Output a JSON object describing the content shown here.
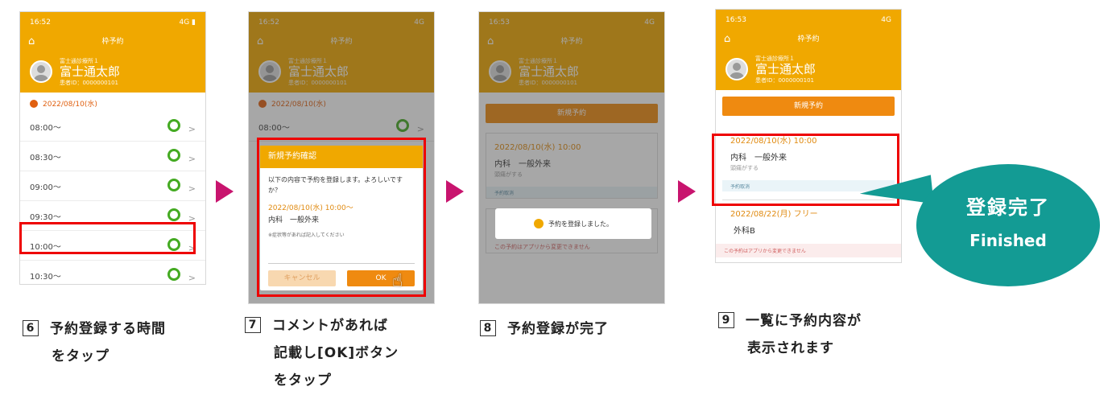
{
  "p6": {
    "time": "16:52",
    "signal": "4G",
    "title": "枠予約",
    "hospital": "富士通診療所１",
    "name": "富士通太郎",
    "pid": "患者ID：0000000101",
    "date": "2022/08/10(水)",
    "slots": [
      "08:00〜",
      "08:30〜",
      "09:00〜",
      "09:30〜",
      "10:00〜",
      "10:30〜"
    ]
  },
  "p7": {
    "time": "16:52",
    "signal": "4G",
    "title": "枠予約",
    "hospital": "富士通診療所１",
    "name": "富士通太郎",
    "pid": "患者ID：0000000101",
    "date": "2022/08/10(水)",
    "slot": "08:00〜",
    "dialog": {
      "title": "新規予約確認",
      "message": "以下の内容で予約を登録します。よろしいですか？",
      "datetime": "2022/08/10(水) 10:00〜",
      "dept": "内科　一般外来",
      "note": "※症状等があれば記入してください",
      "cancel": "キャンセル",
      "ok": "OK"
    }
  },
  "p8": {
    "time": "16:53",
    "signal": "4G",
    "title": "枠予約",
    "hospital": "富士通診療所１",
    "name": "富士通太郎",
    "pid": "患者ID：0000000101",
    "new_btn": "新規予約",
    "card": {
      "datetime": "2022/08/10(水) 10:00",
      "dept": "内科　一般外来",
      "sub": "頭痛がする",
      "footer": "予約取消"
    },
    "toast": "予約を登録しました。",
    "note": "この予約はアプリから変更できません"
  },
  "p9": {
    "time": "16:53",
    "signal": "4G",
    "title": "枠予約",
    "hospital": "富士通診療所１",
    "name": "富士通太郎",
    "pid": "患者ID：0000000101",
    "new_btn": "新規予約",
    "card1": {
      "datetime": "2022/08/10(水) 10:00",
      "dept": "内科　一般外来",
      "sub": "頭痛がする",
      "footer": "予約取消"
    },
    "card2": {
      "datetime": "2022/08/22(月) フリー",
      "dept": "外科B"
    },
    "note": "この予約はアプリから変更できません"
  },
  "bubble": {
    "line1": "登録完了",
    "line2": "Finished"
  },
  "captions": [
    {
      "num": "6",
      "lines": [
        "予約登録する時間",
        "をタップ"
      ]
    },
    {
      "num": "7",
      "lines": [
        "コメントがあれば",
        "記載し[OK]ボタン",
        "をタップ"
      ]
    },
    {
      "num": "8",
      "lines": [
        "予約登録が完了"
      ]
    },
    {
      "num": "9",
      "lines": [
        "一覧に予約内容が",
        "表示されます"
      ]
    }
  ],
  "colors": {
    "header": "#f0a800",
    "accent": "#ef8a10",
    "highlight": "#e00000",
    "arrow": "#c8146e",
    "bubble": "#139b94",
    "available": "#44aa22"
  }
}
